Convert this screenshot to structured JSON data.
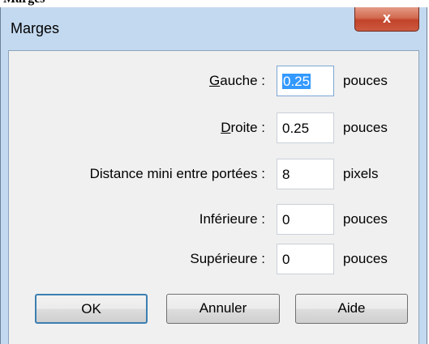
{
  "caption": "Marges",
  "window": {
    "title": "Marges",
    "close_label": "x"
  },
  "fields": [
    {
      "accesskey": "G",
      "label_rest": "auche :",
      "value": "0.25",
      "unit": "pouces"
    },
    {
      "accesskey": "D",
      "label_rest": "roite :",
      "value": "0.25",
      "unit": "pouces"
    },
    {
      "accesskey": "",
      "label_rest": "Distance mini entre portées :",
      "value": "8",
      "unit": "pixels"
    },
    {
      "accesskey": "",
      "label_rest": "Inférieure :",
      "value": "0",
      "unit": "pouces"
    },
    {
      "accesskey": "",
      "label_rest": "Supérieure :",
      "value": "0",
      "unit": "pouces"
    }
  ],
  "buttons": {
    "ok": "OK",
    "cancel": "Annuler",
    "help": "Aide"
  },
  "colors": {
    "frame": "#c3d9ef",
    "close": "#c2432a",
    "selection": "#3399ff"
  }
}
